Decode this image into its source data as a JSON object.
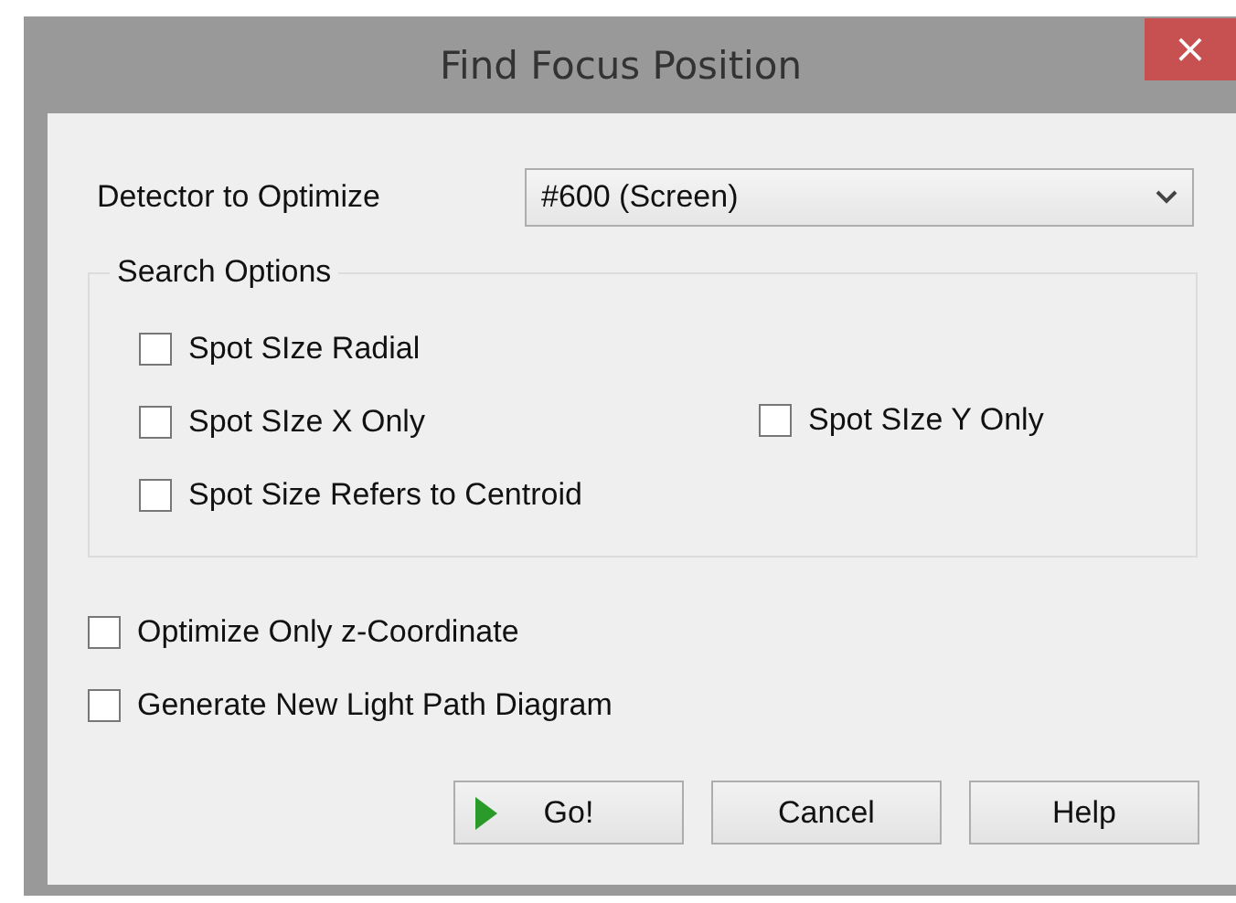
{
  "window": {
    "title": "Find Focus Position",
    "close_label": "×"
  },
  "detector": {
    "label": "Detector to Optimize",
    "value": "#600 (Screen)"
  },
  "search_options": {
    "title": "Search Options",
    "rows": [
      [
        {
          "label": "Spot SIze Radial",
          "checked": false
        }
      ],
      [
        {
          "label": "Spot SIze X Only",
          "checked": false
        },
        {
          "label": "Spot SIze Y Only",
          "checked": false
        }
      ],
      [
        {
          "label": "Spot Size Refers to Centroid",
          "checked": false
        }
      ]
    ]
  },
  "options": [
    {
      "label": "Optimize Only z-Coordinate",
      "checked": false
    },
    {
      "label": "Generate New Light Path Diagram",
      "checked": false
    }
  ],
  "buttons": [
    {
      "label": "Go!",
      "kind": "go"
    },
    {
      "label": "Cancel",
      "kind": "plain"
    },
    {
      "label": "Help",
      "kind": "plain"
    }
  ]
}
